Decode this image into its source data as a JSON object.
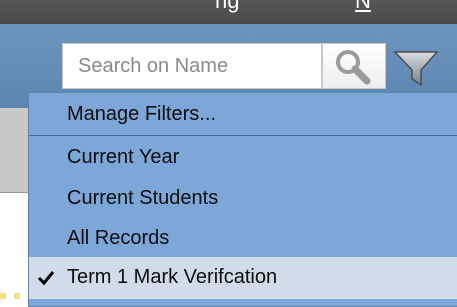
{
  "header": {
    "title_fragment": "ng",
    "underlined_fragment": "N"
  },
  "toolbar": {
    "search": {
      "placeholder": "Search on Name",
      "icon": "search-icon"
    },
    "filter": {
      "icon": "filter-icon"
    }
  },
  "filter_menu": {
    "header": "Manage Filters...",
    "items": [
      {
        "label": "Current Year",
        "checked": false
      },
      {
        "label": "Current Students",
        "checked": false
      },
      {
        "label": "All Records",
        "checked": false
      },
      {
        "label": "Term 1 Mark Verifcation",
        "checked": true
      }
    ]
  },
  "colors": {
    "toolbar": "#6c95bd",
    "menu": "#7ca7d8",
    "selected_row": "#d0dcea"
  }
}
